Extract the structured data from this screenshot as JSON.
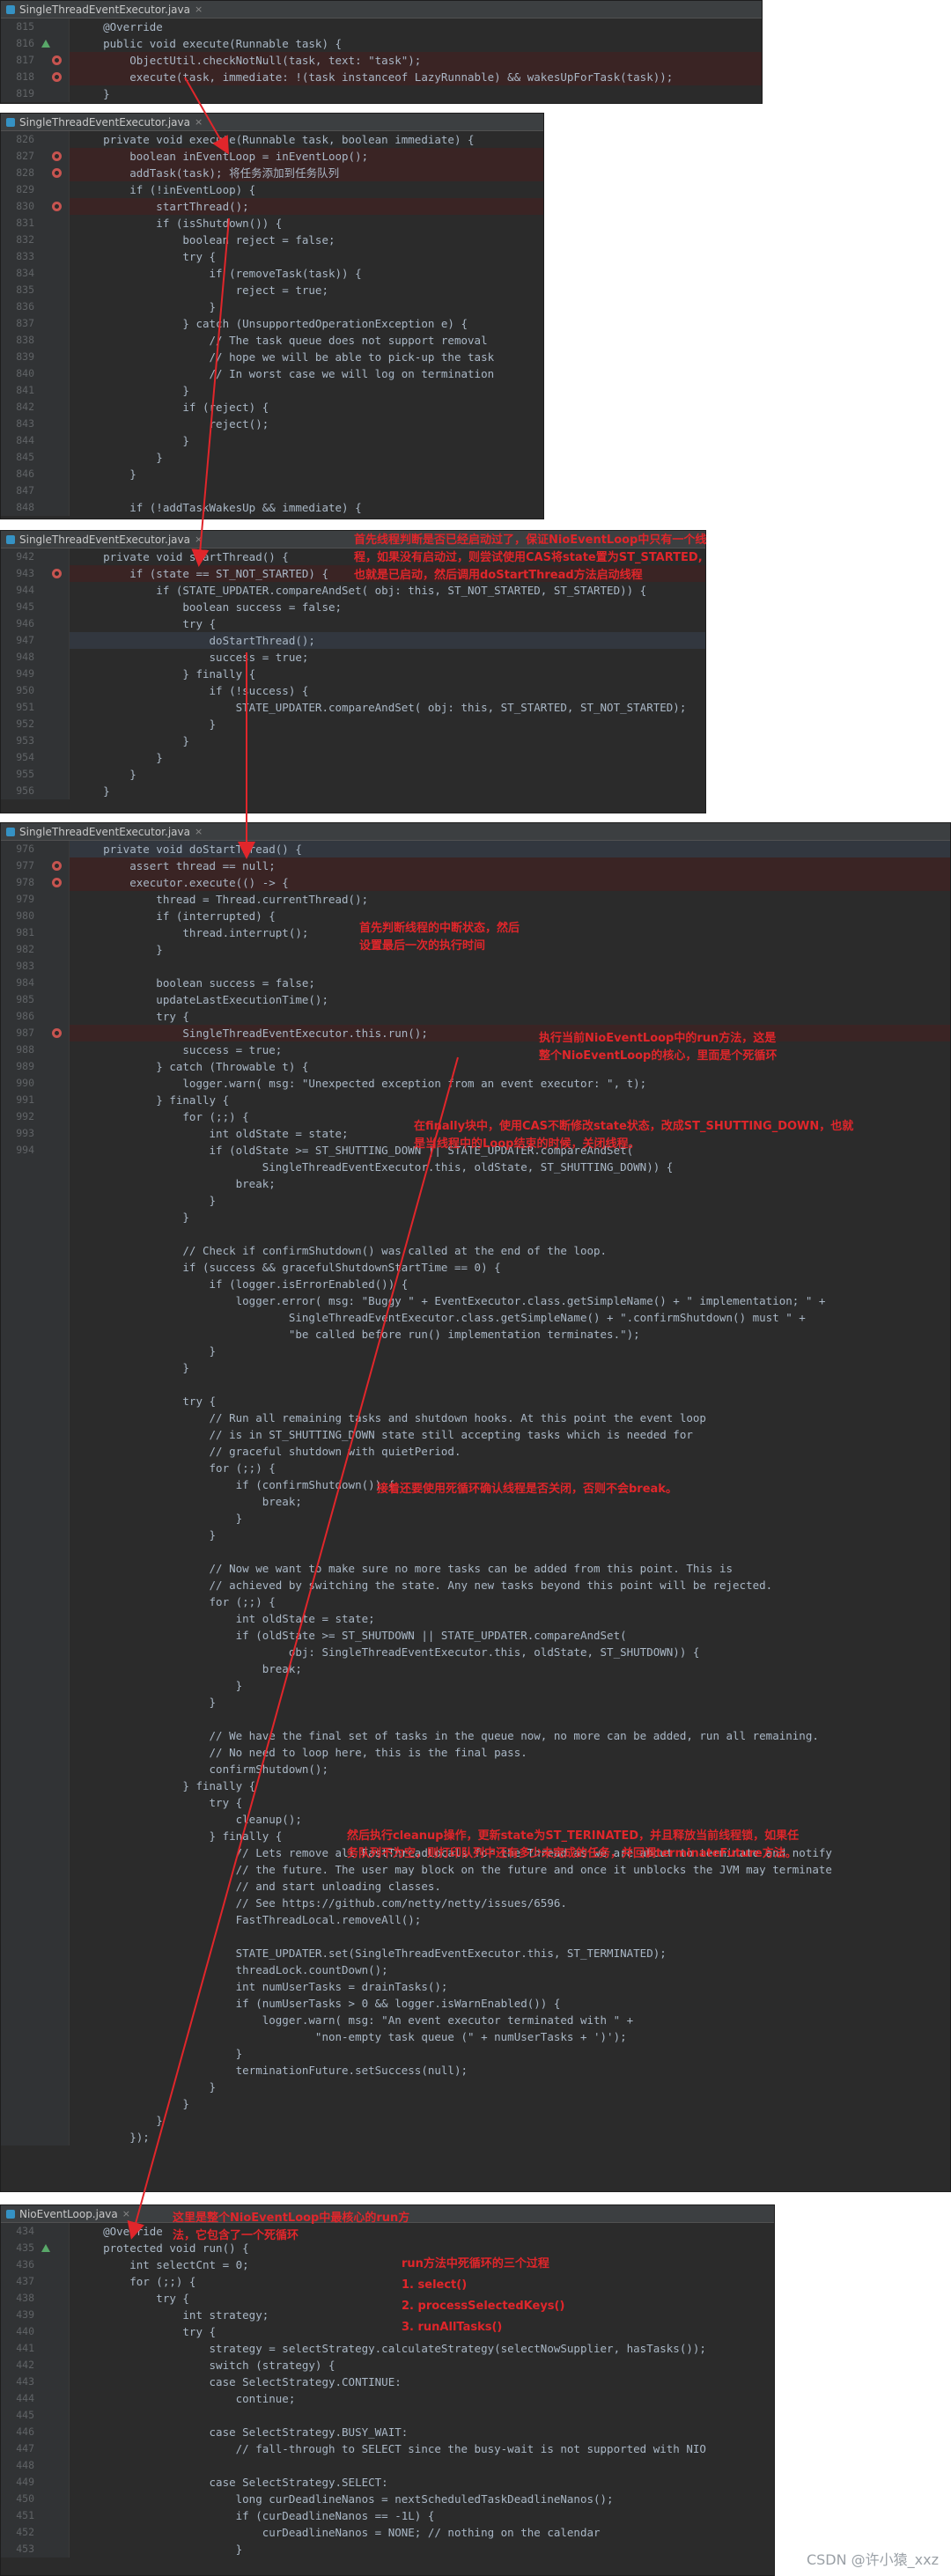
{
  "panels": [
    {
      "tab": "SingleThreadEventExecutor.java",
      "lines": [
        {
          "n": "815",
          "t": "    @Override",
          "m": ""
        },
        {
          "n": "816",
          "t": "    public void execute(Runnable task) {",
          "m": "ov"
        },
        {
          "n": "817",
          "t": "        ObjectUtil.checkNotNull(task, text: \"task\");",
          "m": "bp",
          "hl": true
        },
        {
          "n": "818",
          "t": "        execute(task, immediate: !(task instanceof LazyRunnable) && wakesUpForTask(task));",
          "m": "bp",
          "hl": true
        },
        {
          "n": "819",
          "t": "    }",
          "m": ""
        }
      ]
    },
    {
      "tab": "SingleThreadEventExecutor.java",
      "lines": [
        {
          "n": "826",
          "t": "    private void execute(Runnable task, boolean immediate) {",
          "m": ""
        },
        {
          "n": "827",
          "t": "        boolean inEventLoop = inEventLoop();",
          "m": "bp",
          "hl": true
        },
        {
          "n": "828",
          "t": "        addTask(task); 将任务添加到任务队列",
          "m": "bp",
          "hl": true
        },
        {
          "n": "829",
          "t": "        if (!inEventLoop) {",
          "m": ""
        },
        {
          "n": "830",
          "t": "            startThread();",
          "m": "bp",
          "hl": true
        },
        {
          "n": "831",
          "t": "            if (isShutdown()) {",
          "m": ""
        },
        {
          "n": "832",
          "t": "                boolean reject = false;",
          "m": ""
        },
        {
          "n": "833",
          "t": "                try {",
          "m": ""
        },
        {
          "n": "834",
          "t": "                    if (removeTask(task)) {",
          "m": ""
        },
        {
          "n": "835",
          "t": "                        reject = true;",
          "m": ""
        },
        {
          "n": "836",
          "t": "                    }",
          "m": ""
        },
        {
          "n": "837",
          "t": "                } catch (UnsupportedOperationException e) {",
          "m": ""
        },
        {
          "n": "838",
          "t": "                    // The task queue does not support removal",
          "m": ""
        },
        {
          "n": "839",
          "t": "                    // hope we will be able to pick-up the task",
          "m": ""
        },
        {
          "n": "840",
          "t": "                    // In worst case we will log on termination",
          "m": ""
        },
        {
          "n": "841",
          "t": "                }",
          "m": ""
        },
        {
          "n": "842",
          "t": "                if (reject) {",
          "m": ""
        },
        {
          "n": "843",
          "t": "                    reject();",
          "m": ""
        },
        {
          "n": "844",
          "t": "                }",
          "m": ""
        },
        {
          "n": "845",
          "t": "            }",
          "m": ""
        },
        {
          "n": "846",
          "t": "        }",
          "m": ""
        },
        {
          "n": "847",
          "t": "",
          "m": ""
        },
        {
          "n": "848",
          "t": "        if (!addTaskWakesUp && immediate) {",
          "m": ""
        }
      ]
    },
    {
      "tab": "SingleThreadEventExecutor.java",
      "lines": [
        {
          "n": "942",
          "t": "    private void startThread() {",
          "m": ""
        },
        {
          "n": "943",
          "t": "        if (state == ST_NOT_STARTED) {",
          "m": "bp",
          "hl": true
        },
        {
          "n": "944",
          "t": "            if (STATE_UPDATER.compareAndSet( obj: this, ST_NOT_STARTED, ST_STARTED)) {",
          "m": ""
        },
        {
          "n": "945",
          "t": "                boolean success = false;",
          "m": ""
        },
        {
          "n": "946",
          "t": "                try {",
          "m": ""
        },
        {
          "n": "947",
          "t": "                    doStartThread();",
          "m": "",
          "sel": true
        },
        {
          "n": "948",
          "t": "                    success = true;",
          "m": ""
        },
        {
          "n": "949",
          "t": "                } finally {",
          "m": ""
        },
        {
          "n": "950",
          "t": "                    if (!success) {",
          "m": ""
        },
        {
          "n": "951",
          "t": "                        STATE_UPDATER.compareAndSet( obj: this, ST_STARTED, ST_NOT_STARTED);",
          "m": ""
        },
        {
          "n": "952",
          "t": "                    }",
          "m": ""
        },
        {
          "n": "953",
          "t": "                }",
          "m": ""
        },
        {
          "n": "954",
          "t": "            }",
          "m": ""
        },
        {
          "n": "955",
          "t": "        }",
          "m": ""
        },
        {
          "n": "956",
          "t": "    }",
          "m": ""
        }
      ]
    },
    {
      "tab": "SingleThreadEventExecutor.java",
      "lines": [
        {
          "n": "976",
          "t": "    private void doStartThread() {",
          "m": "",
          "sel": true
        },
        {
          "n": "977",
          "t": "        assert thread == null;",
          "m": "bp",
          "hl": true
        },
        {
          "n": "978",
          "t": "        executor.execute(() -> {",
          "m": "bp",
          "hl": true
        },
        {
          "n": "979",
          "t": "            thread = Thread.currentThread();",
          "m": ""
        },
        {
          "n": "980",
          "t": "            if (interrupted) {",
          "m": ""
        },
        {
          "n": "981",
          "t": "                thread.interrupt();",
          "m": ""
        },
        {
          "n": "982",
          "t": "            }",
          "m": ""
        },
        {
          "n": "983",
          "t": "",
          "m": ""
        },
        {
          "n": "984",
          "t": "            boolean success = false;",
          "m": ""
        },
        {
          "n": "985",
          "t": "            updateLastExecutionTime();",
          "m": ""
        },
        {
          "n": "986",
          "t": "            try {",
          "m": ""
        },
        {
          "n": "987",
          "t": "                SingleThreadEventExecutor.this.run();",
          "m": "bp",
          "hl": true
        },
        {
          "n": "988",
          "t": "                success = true;",
          "m": ""
        },
        {
          "n": "989",
          "t": "            } catch (Throwable t) {",
          "m": ""
        },
        {
          "n": "990",
          "t": "                logger.warn( msg: \"Unexpected exception from an event executor: \", t);",
          "m": ""
        },
        {
          "n": "991",
          "t": "            } finally {",
          "m": ""
        },
        {
          "n": "992",
          "t": "                for (;;) {",
          "m": ""
        },
        {
          "n": "993",
          "t": "                    int oldState = state;",
          "m": ""
        },
        {
          "n": "994",
          "t": "                    if (oldState >= ST_SHUTTING_DOWN || STATE_UPDATER.compareAndSet(",
          "m": ""
        },
        {
          "n": "",
          "t": "                            SingleThreadEventExecutor.this, oldState, ST_SHUTTING_DOWN)) {",
          "m": ""
        },
        {
          "n": "",
          "t": "                        break;",
          "m": ""
        },
        {
          "n": "",
          "t": "                    }",
          "m": ""
        },
        {
          "n": "",
          "t": "                }",
          "m": ""
        },
        {
          "n": "",
          "t": "",
          "m": ""
        },
        {
          "n": "",
          "t": "                // Check if confirmShutdown() was called at the end of the loop.",
          "m": ""
        },
        {
          "n": "",
          "t": "                if (success && gracefulShutdownStartTime == 0) {",
          "m": ""
        },
        {
          "n": "",
          "t": "                    if (logger.isErrorEnabled()) {",
          "m": ""
        },
        {
          "n": "",
          "t": "                        logger.error( msg: \"Buggy \" + EventExecutor.class.getSimpleName() + \" implementation; \" +",
          "m": ""
        },
        {
          "n": "",
          "t": "                                SingleThreadEventExecutor.class.getSimpleName() + \".confirmShutdown() must \" +",
          "m": ""
        },
        {
          "n": "",
          "t": "                                \"be called before run() implementation terminates.\");",
          "m": ""
        },
        {
          "n": "",
          "t": "                    }",
          "m": ""
        },
        {
          "n": "",
          "t": "                }",
          "m": ""
        },
        {
          "n": "",
          "t": "",
          "m": ""
        },
        {
          "n": "",
          "t": "                try {",
          "m": ""
        },
        {
          "n": "",
          "t": "                    // Run all remaining tasks and shutdown hooks. At this point the event loop",
          "m": ""
        },
        {
          "n": "",
          "t": "                    // is in ST_SHUTTING_DOWN state still accepting tasks which is needed for",
          "m": ""
        },
        {
          "n": "",
          "t": "                    // graceful shutdown with quietPeriod.",
          "m": ""
        },
        {
          "n": "",
          "t": "                    for (;;) {",
          "m": ""
        },
        {
          "n": "",
          "t": "                        if (confirmShutdown()) {",
          "m": ""
        },
        {
          "n": "",
          "t": "                            break;",
          "m": ""
        },
        {
          "n": "",
          "t": "                        }",
          "m": ""
        },
        {
          "n": "",
          "t": "                    }",
          "m": ""
        },
        {
          "n": "",
          "t": "",
          "m": ""
        },
        {
          "n": "",
          "t": "                    // Now we want to make sure no more tasks can be added from this point. This is",
          "m": ""
        },
        {
          "n": "",
          "t": "                    // achieved by switching the state. Any new tasks beyond this point will be rejected.",
          "m": ""
        },
        {
          "n": "",
          "t": "                    for (;;) {",
          "m": ""
        },
        {
          "n": "",
          "t": "                        int oldState = state;",
          "m": ""
        },
        {
          "n": "",
          "t": "                        if (oldState >= ST_SHUTDOWN || STATE_UPDATER.compareAndSet(",
          "m": ""
        },
        {
          "n": "",
          "t": "                                obj: SingleThreadEventExecutor.this, oldState, ST_SHUTDOWN)) {",
          "m": ""
        },
        {
          "n": "",
          "t": "                            break;",
          "m": ""
        },
        {
          "n": "",
          "t": "                        }",
          "m": ""
        },
        {
          "n": "",
          "t": "                    }",
          "m": ""
        },
        {
          "n": "",
          "t": "",
          "m": ""
        },
        {
          "n": "",
          "t": "                    // We have the final set of tasks in the queue now, no more can be added, run all remaining.",
          "m": ""
        },
        {
          "n": "",
          "t": "                    // No need to loop here, this is the final pass.",
          "m": ""
        },
        {
          "n": "",
          "t": "                    confirmShutdown();",
          "m": ""
        },
        {
          "n": "",
          "t": "                } finally {",
          "m": ""
        },
        {
          "n": "",
          "t": "                    try {",
          "m": ""
        },
        {
          "n": "",
          "t": "                        cleanup();",
          "m": ""
        },
        {
          "n": "",
          "t": "                    } finally {",
          "m": ""
        },
        {
          "n": "",
          "t": "                        // Lets remove all FastThreadLocals for the Thread as we are about to terminate and notify",
          "m": ""
        },
        {
          "n": "",
          "t": "                        // the future. The user may block on the future and once it unblocks the JVM may terminate",
          "m": ""
        },
        {
          "n": "",
          "t": "                        // and start unloading classes.",
          "m": ""
        },
        {
          "n": "",
          "t": "                        // See https://github.com/netty/netty/issues/6596.",
          "m": ""
        },
        {
          "n": "",
          "t": "                        FastThreadLocal.removeAll();",
          "m": ""
        },
        {
          "n": "",
          "t": "",
          "m": ""
        },
        {
          "n": "",
          "t": "                        STATE_UPDATER.set(SingleThreadEventExecutor.this, ST_TERMINATED);",
          "m": ""
        },
        {
          "n": "",
          "t": "                        threadLock.countDown();",
          "m": ""
        },
        {
          "n": "",
          "t": "                        int numUserTasks = drainTasks();",
          "m": ""
        },
        {
          "n": "",
          "t": "                        if (numUserTasks > 0 && logger.isWarnEnabled()) {",
          "m": ""
        },
        {
          "n": "",
          "t": "                            logger.warn( msg: \"An event executor terminated with \" +",
          "m": ""
        },
        {
          "n": "",
          "t": "                                    \"non-empty task queue (\" + numUserTasks + ')');",
          "m": ""
        },
        {
          "n": "",
          "t": "                        }",
          "m": ""
        },
        {
          "n": "",
          "t": "                        terminationFuture.setSuccess(null);",
          "m": ""
        },
        {
          "n": "",
          "t": "                    }",
          "m": ""
        },
        {
          "n": "",
          "t": "                }",
          "m": ""
        },
        {
          "n": "",
          "t": "            }",
          "m": ""
        },
        {
          "n": "",
          "t": "        });",
          "m": ""
        }
      ]
    },
    {
      "tab": "NioEventLoop.java",
      "lines": [
        {
          "n": "434",
          "t": "    @Override",
          "m": ""
        },
        {
          "n": "435",
          "t": "    protected void run() {",
          "m": "ov"
        },
        {
          "n": "436",
          "t": "        int selectCnt = 0;",
          "m": ""
        },
        {
          "n": "437",
          "t": "        for (;;) {",
          "m": ""
        },
        {
          "n": "438",
          "t": "            try {",
          "m": ""
        },
        {
          "n": "439",
          "t": "                int strategy;",
          "m": ""
        },
        {
          "n": "440",
          "t": "                try {",
          "m": ""
        },
        {
          "n": "441",
          "t": "                    strategy = selectStrategy.calculateStrategy(selectNowSupplier, hasTasks());",
          "m": ""
        },
        {
          "n": "442",
          "t": "                    switch (strategy) {",
          "m": ""
        },
        {
          "n": "443",
          "t": "                    case SelectStrategy.CONTINUE:",
          "m": ""
        },
        {
          "n": "444",
          "t": "                        continue;",
          "m": ""
        },
        {
          "n": "445",
          "t": "",
          "m": ""
        },
        {
          "n": "446",
          "t": "                    case SelectStrategy.BUSY_WAIT:",
          "m": ""
        },
        {
          "n": "447",
          "t": "                        // fall-through to SELECT since the busy-wait is not supported with NIO",
          "m": ""
        },
        {
          "n": "448",
          "t": "",
          "m": ""
        },
        {
          "n": "449",
          "t": "                    case SelectStrategy.SELECT:",
          "m": ""
        },
        {
          "n": "450",
          "t": "                        long curDeadlineNanos = nextScheduledTaskDeadlineNanos();",
          "m": ""
        },
        {
          "n": "451",
          "t": "                        if (curDeadlineNanos == -1L) {",
          "m": ""
        },
        {
          "n": "452",
          "t": "                            curDeadlineNanos = NONE; // nothing on the calendar",
          "m": ""
        },
        {
          "n": "453",
          "t": "                        }",
          "m": ""
        }
      ]
    }
  ],
  "notes": {
    "start_thread": [
      "首先线程判断是否已经启动过了，保证NioEventLoop中只有一个线",
      "程，如果没有启动过，则尝试使用CAS将state置为ST_STARTED,",
      "也就是已启动，然后调用doStartThread方法启动线程"
    ],
    "interrupt": [
      "首先判断线程的中断状态，然后",
      "设置最后一次的执行时间"
    ],
    "run_call": [
      "执行当前NioEventLoop中的run方法，这是",
      "整个NioEventLoop的核心，里面是个死循环"
    ],
    "finally_block": [
      "在finally块中，使用CAS不断修改state状态，改成ST_SHUTTING_DOWN，也就",
      "是当线程中的Loop结束的时候，关闭线程。"
    ],
    "confirm": [
      "接着还要使用死循环确认线程是否关闭，否则不会break。"
    ],
    "cleanup": [
      "然后执行cleanup操作，更新state为ST_TERINATED，并且释放当前线程锁，如果任",
      "务队列不为空，则打印队列中还有多少未完成的任务，并回调terminateFuture方法。"
    ],
    "nio_run": [
      "这里是整个NioEventLoop中最核心的run方",
      "法，它包含了一个死循环"
    ],
    "run_steps": [
      "run方法中死循环的三个过程",
      "1. select()",
      "2. processSelectedKeys()",
      "3. runAllTasks()"
    ]
  },
  "watermark": "CSDN @许小猿_xxz",
  "colors": {
    "annotation": "#e0262b",
    "editor_bg": "#2b2b2b",
    "gutter": "#313335",
    "tab_bg": "#3c3f41",
    "breakpoint": "#c75450"
  }
}
